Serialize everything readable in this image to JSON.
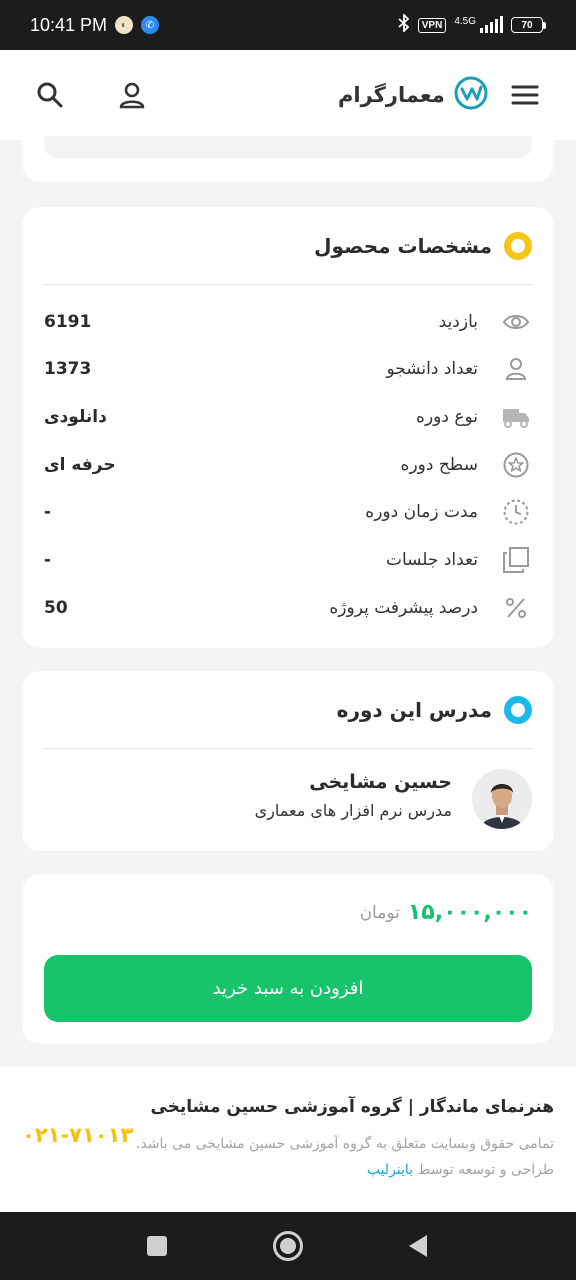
{
  "status_bar": {
    "time": "10:41 PM",
    "vpn": "VPN",
    "network": "4.5G",
    "battery": "70"
  },
  "header": {
    "logo_text": "معمارگرام",
    "icons": [
      "menu-icon",
      "logo-icon",
      "user-icon",
      "search-icon"
    ]
  },
  "specs": {
    "title": "مشخصات محصول",
    "accent": "#f5c518",
    "rows": [
      {
        "label": "بازدید",
        "value": "6191",
        "icon": "eye-icon"
      },
      {
        "label": "تعداد دانشجو",
        "value": "1373",
        "icon": "user-icon"
      },
      {
        "label": "نوع دوره",
        "value": "دانلودی",
        "icon": "truck-icon"
      },
      {
        "label": "سطح دوره",
        "value": "حرفه ای",
        "icon": "star-icon"
      },
      {
        "label": "مدت زمان دوره",
        "value": "-",
        "icon": "clock-icon"
      },
      {
        "label": "تعداد جلسات",
        "value": "-",
        "icon": "copy-icon"
      },
      {
        "label": "درصد پیشرفت پروژه",
        "value": "50",
        "icon": "percent-icon"
      }
    ]
  },
  "teacher": {
    "title": "مدرس این دوره",
    "accent": "#1bb8ea",
    "name": "حسین مشایخی",
    "role": "مدرس نرم افزار های معماری"
  },
  "purchase": {
    "price": "۱۵,۰۰۰,۰۰۰",
    "currency": "تومان",
    "button_label": "افزودن به سبد خرید",
    "accent": "#17c46c"
  },
  "footer": {
    "title": "هنرنمای ماندگار | گروه آموزشی حسین مشایخی",
    "description": "تمامی حقوق وبسایت متعلق به گروه آموزشی حسین مشایخی می باشد. طراحی و توسعه توسط",
    "developer_link": "باینرلیپ",
    "phone": "۰۲۱-۷۱۰۱۳"
  }
}
